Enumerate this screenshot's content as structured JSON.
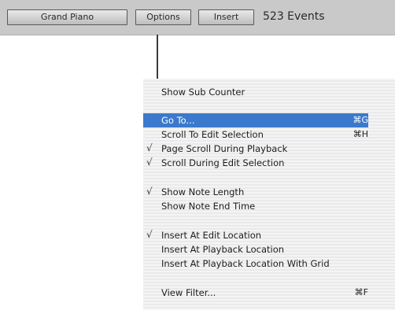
{
  "toolbar": {
    "instrument_label": "Grand Piano",
    "options_label": "Options",
    "insert_label": "Insert",
    "events_count": "523 Events"
  },
  "menu": {
    "show_sub_counter": "Show Sub Counter",
    "go_to": "Go To...",
    "go_to_shortcut": "⌘G",
    "scroll_to_edit_selection": "Scroll To Edit Selection",
    "scroll_to_edit_selection_shortcut": "⌘H",
    "page_scroll_during_playback": "Page Scroll During Playback",
    "scroll_during_edit_selection": "Scroll During Edit Selection",
    "show_note_length": "Show Note Length",
    "show_note_end_time": "Show Note End Time",
    "insert_at_edit_location": "Insert At Edit Location",
    "insert_at_playback_location": "Insert At Playback Location",
    "insert_at_playback_location_with_grid": "Insert At Playback Location With Grid",
    "view_filter": "View Filter...",
    "view_filter_shortcut": "⌘F",
    "check_mark": "√"
  },
  "colors": {
    "highlight": "#3b79cc",
    "toolbar_bg": "#c9c9c9"
  }
}
